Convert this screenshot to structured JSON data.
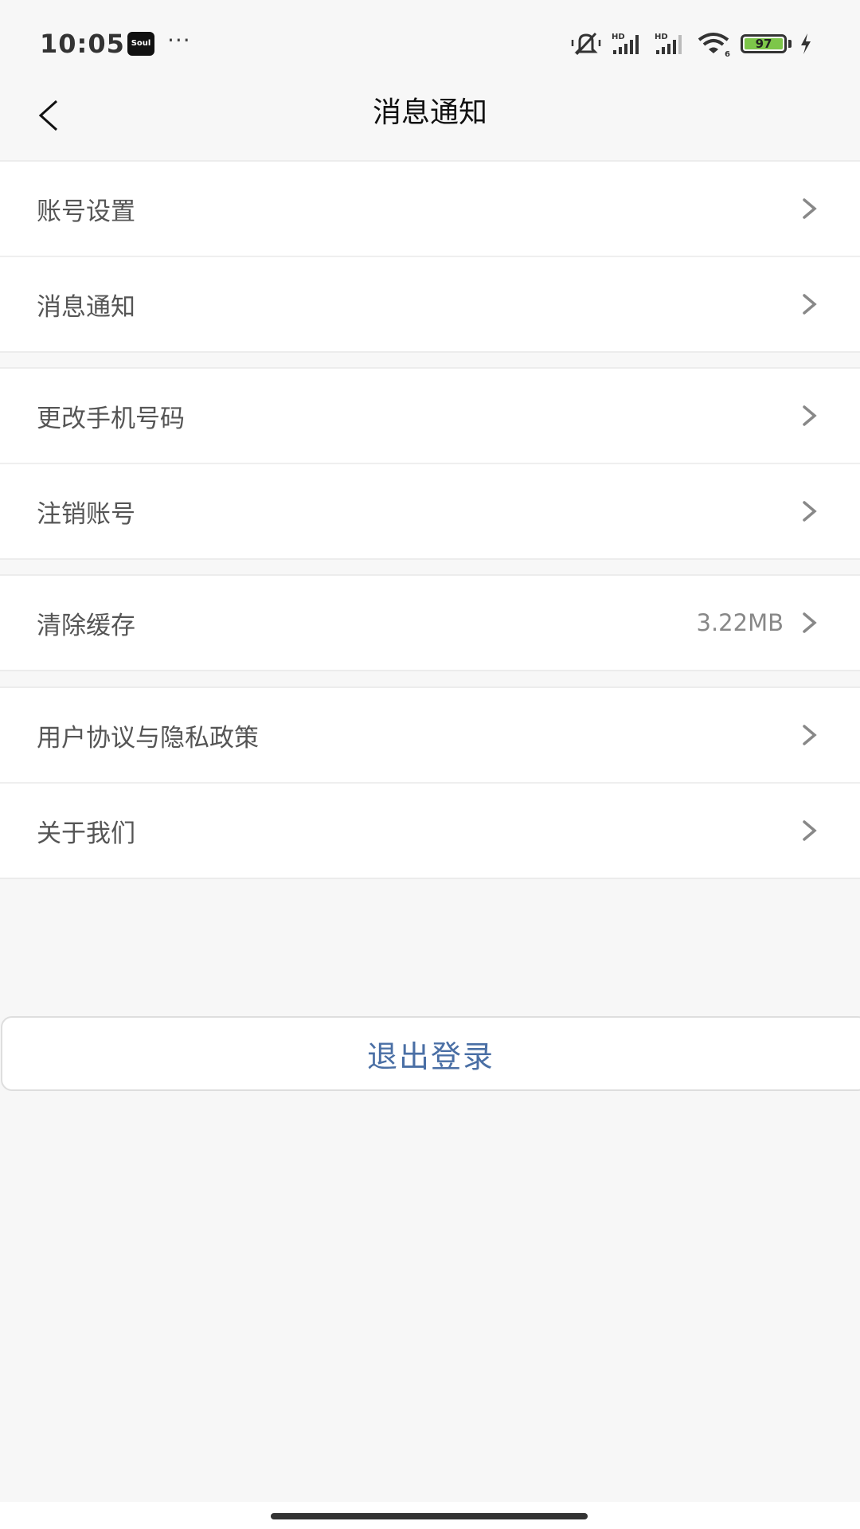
{
  "status_bar": {
    "time": "10:05",
    "app_badge": "Soul",
    "more": "···",
    "icons": [
      "mute-icon",
      "signal-hd-icon",
      "signal-hd-icon",
      "wifi-6-icon",
      "battery-icon",
      "charging-icon"
    ],
    "battery_level": "97",
    "battery_color": "#7dc64a"
  },
  "header": {
    "back_icon": "chevron-left-icon",
    "title": "消息通知"
  },
  "groups": [
    {
      "items": [
        {
          "label": "账号设置"
        },
        {
          "label": "消息通知"
        }
      ]
    },
    {
      "items": [
        {
          "label": "更改手机号码"
        },
        {
          "label": "注销账号"
        }
      ]
    },
    {
      "items": [
        {
          "label": "清除缓存",
          "value": "3.22MB"
        }
      ]
    },
    {
      "items": [
        {
          "label": "用户协议与隐私政策"
        },
        {
          "label": "关于我们"
        }
      ]
    }
  ],
  "logout": {
    "label": "退出登录",
    "color": "#4a6fa5"
  }
}
